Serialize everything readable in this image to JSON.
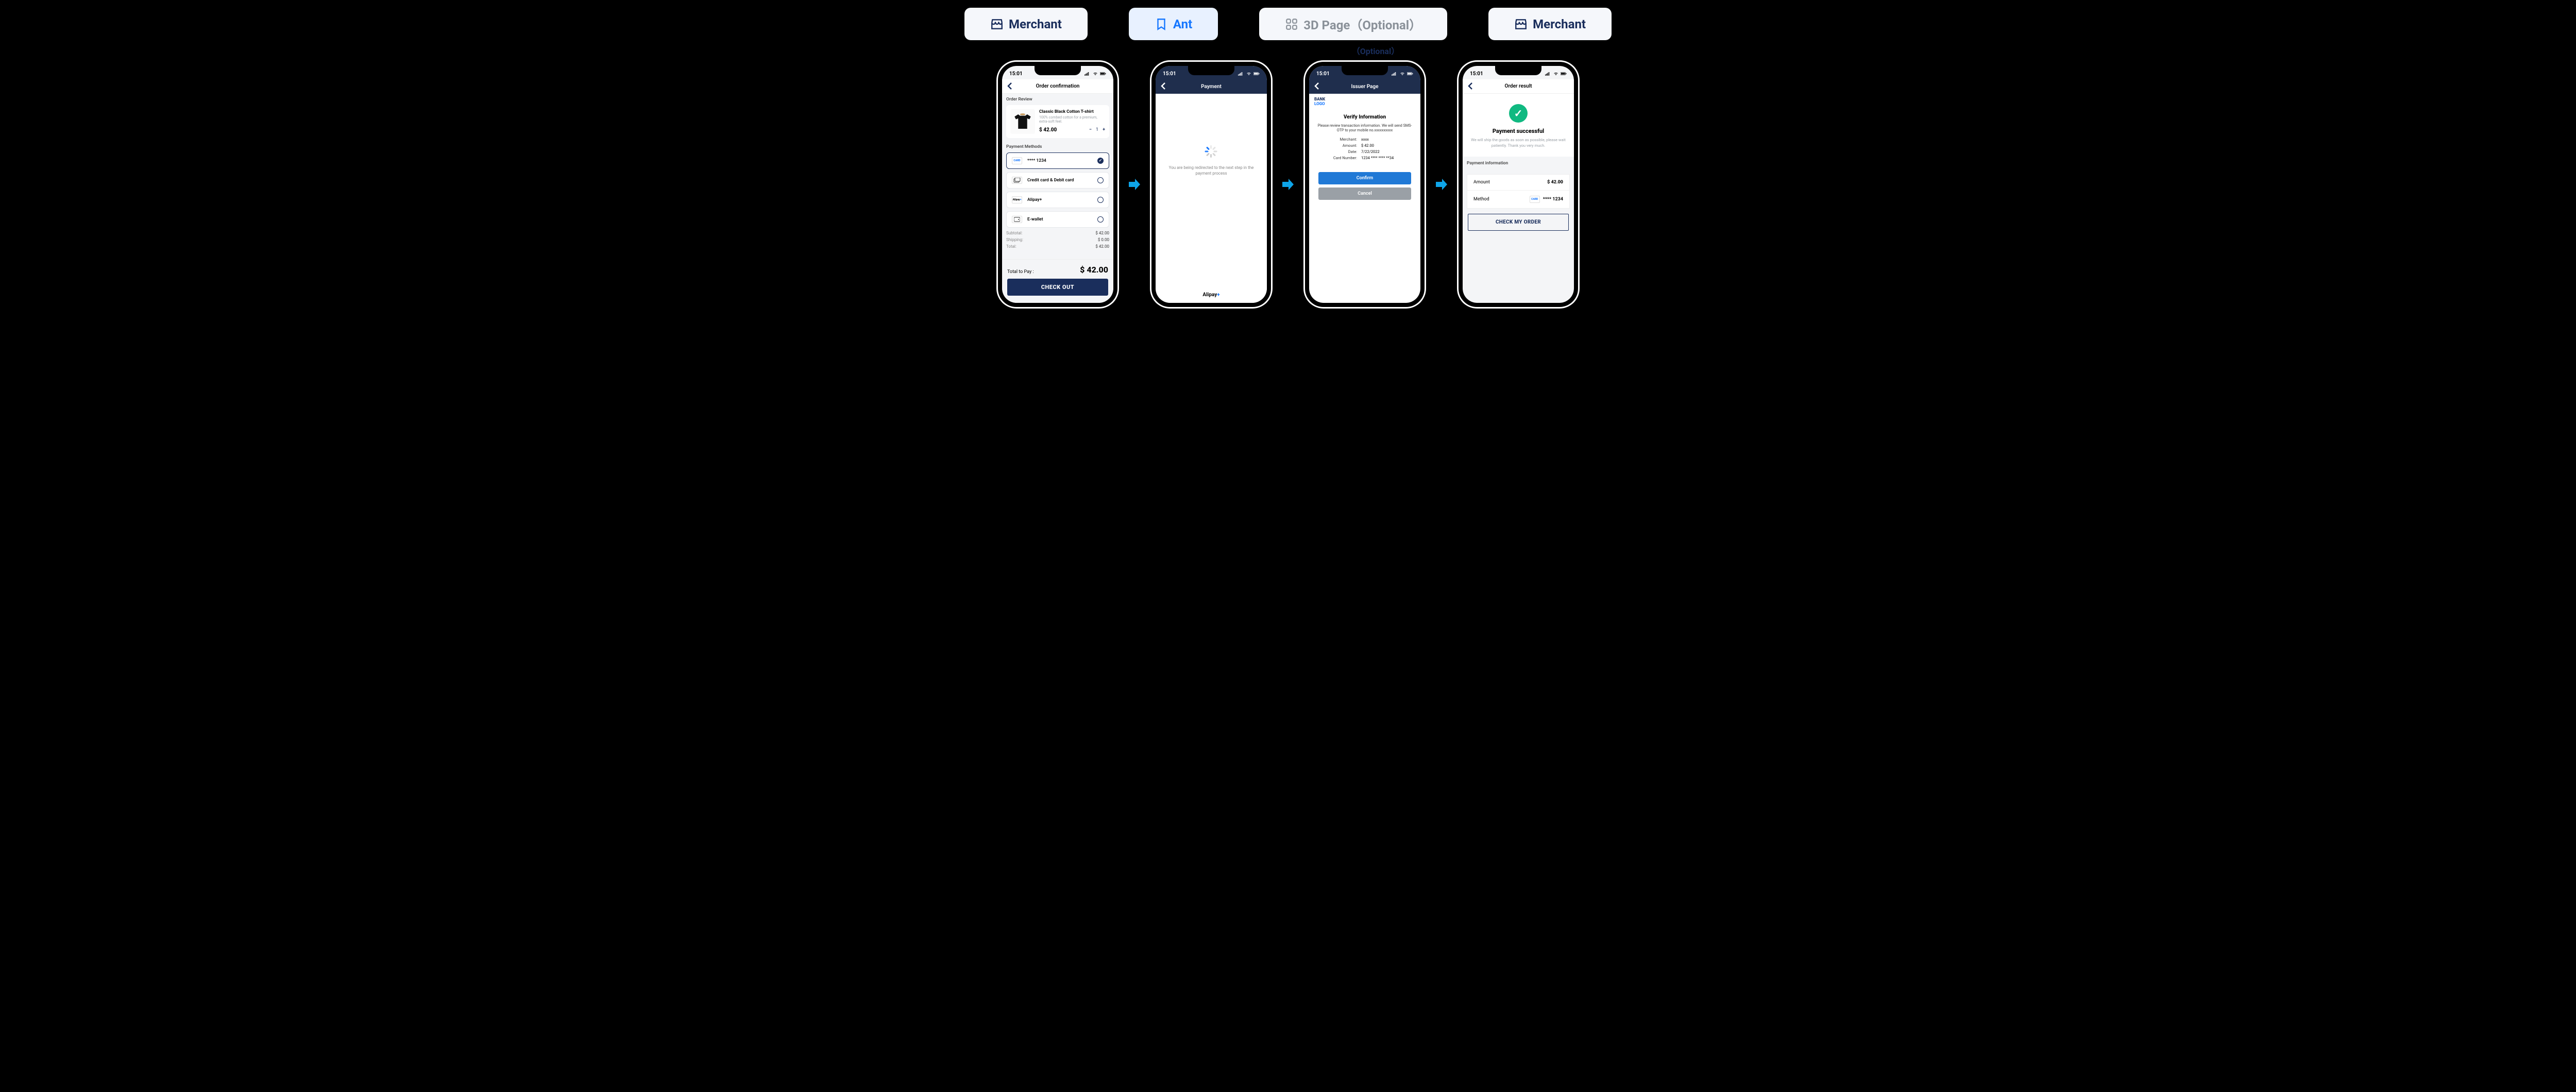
{
  "tabs": [
    {
      "label": "Merchant",
      "kind": "merchant",
      "active": false
    },
    {
      "label": "Ant",
      "kind": "ant",
      "active": true
    },
    {
      "label": "3D Page（Optional）",
      "kind": "3d",
      "active": false,
      "grey": true
    },
    {
      "label": "Merchant",
      "kind": "merchant",
      "active": false
    }
  ],
  "optional_caption": "（Optional）",
  "time": "15:01",
  "phone1": {
    "nav": "Order confirmation",
    "review_h": "Order Review",
    "product": {
      "title": "Classic Black Cotton T-shirt",
      "desc": "100% combed cotton for a premium, extra-soft feel.",
      "price": "$ 42.00",
      "qty": "1"
    },
    "pm_h": "Payment Methods",
    "methods": [
      {
        "label": "**** 1234",
        "icon": "card",
        "selected": true
      },
      {
        "label": "Credit card & Debit card",
        "icon": "cards",
        "selected": false
      },
      {
        "label": "Alipay+",
        "icon": "alipay",
        "selected": false
      },
      {
        "label": "E-wallet",
        "icon": "wallet",
        "selected": false
      }
    ],
    "summary": [
      {
        "k": "Subtotal:",
        "v": "$ 42.00"
      },
      {
        "k": "Shipping:",
        "v": "$ 0.00"
      },
      {
        "k": "Total:",
        "v": "$ 42.00"
      }
    ],
    "total_label": "Total to Pay :",
    "total": "$ 42.00",
    "cta": "CHECK OUT"
  },
  "phone2": {
    "nav": "Payment",
    "redirect": "You are being redirected to the next step in the payment process",
    "footer": "Alipay",
    "footer_plus": "+"
  },
  "phone3": {
    "nav": "Issuer Page",
    "bank_l1": "BANK",
    "bank_l2": "LOGO",
    "verify_h": "Verify Information",
    "verify_p": "Please review transaction information. We will send SMS-OTP to your mobile no.xxxxxxxxxx",
    "rows": [
      {
        "k": "Merchant:",
        "v": "xxxx"
      },
      {
        "k": "Amount:",
        "v": "$ 42.00"
      },
      {
        "k": "Date:",
        "v": "7/22/2022"
      },
      {
        "k": "Card Number:",
        "v": "1234 **** **** **34"
      }
    ],
    "confirm": "Confirm",
    "cancel": "Cancel"
  },
  "phone4": {
    "nav": "Order result",
    "success_h": "Payment successful",
    "success_p": "We will ship the goods as soon as possible, please wait patiently. Thank you very much.",
    "info_h": "Payment information",
    "amount_k": "Amount",
    "amount_v": "$ 42.00",
    "method_k": "Method",
    "method_card": "**** 1234",
    "cta": "CHECK MY ORDER"
  }
}
